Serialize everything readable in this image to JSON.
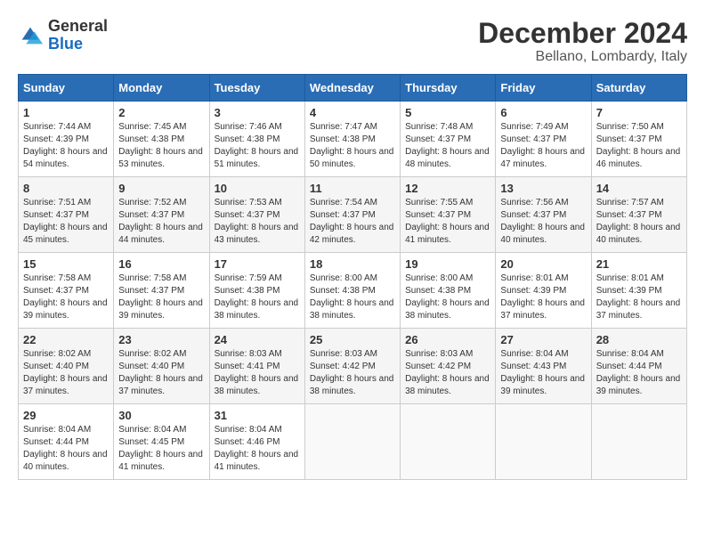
{
  "logo": {
    "general": "General",
    "blue": "Blue"
  },
  "header": {
    "month": "December 2024",
    "location": "Bellano, Lombardy, Italy"
  },
  "weekdays": [
    "Sunday",
    "Monday",
    "Tuesday",
    "Wednesday",
    "Thursday",
    "Friday",
    "Saturday"
  ],
  "weeks": [
    [
      {
        "day": "1",
        "sunrise": "7:44 AM",
        "sunset": "4:39 PM",
        "daylight": "8 hours and 54 minutes."
      },
      {
        "day": "2",
        "sunrise": "7:45 AM",
        "sunset": "4:38 PM",
        "daylight": "8 hours and 53 minutes."
      },
      {
        "day": "3",
        "sunrise": "7:46 AM",
        "sunset": "4:38 PM",
        "daylight": "8 hours and 51 minutes."
      },
      {
        "day": "4",
        "sunrise": "7:47 AM",
        "sunset": "4:38 PM",
        "daylight": "8 hours and 50 minutes."
      },
      {
        "day": "5",
        "sunrise": "7:48 AM",
        "sunset": "4:37 PM",
        "daylight": "8 hours and 48 minutes."
      },
      {
        "day": "6",
        "sunrise": "7:49 AM",
        "sunset": "4:37 PM",
        "daylight": "8 hours and 47 minutes."
      },
      {
        "day": "7",
        "sunrise": "7:50 AM",
        "sunset": "4:37 PM",
        "daylight": "8 hours and 46 minutes."
      }
    ],
    [
      {
        "day": "8",
        "sunrise": "7:51 AM",
        "sunset": "4:37 PM",
        "daylight": "8 hours and 45 minutes."
      },
      {
        "day": "9",
        "sunrise": "7:52 AM",
        "sunset": "4:37 PM",
        "daylight": "8 hours and 44 minutes."
      },
      {
        "day": "10",
        "sunrise": "7:53 AM",
        "sunset": "4:37 PM",
        "daylight": "8 hours and 43 minutes."
      },
      {
        "day": "11",
        "sunrise": "7:54 AM",
        "sunset": "4:37 PM",
        "daylight": "8 hours and 42 minutes."
      },
      {
        "day": "12",
        "sunrise": "7:55 AM",
        "sunset": "4:37 PM",
        "daylight": "8 hours and 41 minutes."
      },
      {
        "day": "13",
        "sunrise": "7:56 AM",
        "sunset": "4:37 PM",
        "daylight": "8 hours and 40 minutes."
      },
      {
        "day": "14",
        "sunrise": "7:57 AM",
        "sunset": "4:37 PM",
        "daylight": "8 hours and 40 minutes."
      }
    ],
    [
      {
        "day": "15",
        "sunrise": "7:58 AM",
        "sunset": "4:37 PM",
        "daylight": "8 hours and 39 minutes."
      },
      {
        "day": "16",
        "sunrise": "7:58 AM",
        "sunset": "4:37 PM",
        "daylight": "8 hours and 39 minutes."
      },
      {
        "day": "17",
        "sunrise": "7:59 AM",
        "sunset": "4:38 PM",
        "daylight": "8 hours and 38 minutes."
      },
      {
        "day": "18",
        "sunrise": "8:00 AM",
        "sunset": "4:38 PM",
        "daylight": "8 hours and 38 minutes."
      },
      {
        "day": "19",
        "sunrise": "8:00 AM",
        "sunset": "4:38 PM",
        "daylight": "8 hours and 38 minutes."
      },
      {
        "day": "20",
        "sunrise": "8:01 AM",
        "sunset": "4:39 PM",
        "daylight": "8 hours and 37 minutes."
      },
      {
        "day": "21",
        "sunrise": "8:01 AM",
        "sunset": "4:39 PM",
        "daylight": "8 hours and 37 minutes."
      }
    ],
    [
      {
        "day": "22",
        "sunrise": "8:02 AM",
        "sunset": "4:40 PM",
        "daylight": "8 hours and 37 minutes."
      },
      {
        "day": "23",
        "sunrise": "8:02 AM",
        "sunset": "4:40 PM",
        "daylight": "8 hours and 37 minutes."
      },
      {
        "day": "24",
        "sunrise": "8:03 AM",
        "sunset": "4:41 PM",
        "daylight": "8 hours and 38 minutes."
      },
      {
        "day": "25",
        "sunrise": "8:03 AM",
        "sunset": "4:42 PM",
        "daylight": "8 hours and 38 minutes."
      },
      {
        "day": "26",
        "sunrise": "8:03 AM",
        "sunset": "4:42 PM",
        "daylight": "8 hours and 38 minutes."
      },
      {
        "day": "27",
        "sunrise": "8:04 AM",
        "sunset": "4:43 PM",
        "daylight": "8 hours and 39 minutes."
      },
      {
        "day": "28",
        "sunrise": "8:04 AM",
        "sunset": "4:44 PM",
        "daylight": "8 hours and 39 minutes."
      }
    ],
    [
      {
        "day": "29",
        "sunrise": "8:04 AM",
        "sunset": "4:44 PM",
        "daylight": "8 hours and 40 minutes."
      },
      {
        "day": "30",
        "sunrise": "8:04 AM",
        "sunset": "4:45 PM",
        "daylight": "8 hours and 41 minutes."
      },
      {
        "day": "31",
        "sunrise": "8:04 AM",
        "sunset": "4:46 PM",
        "daylight": "8 hours and 41 minutes."
      },
      null,
      null,
      null,
      null
    ]
  ],
  "labels": {
    "sunrise": "Sunrise:",
    "sunset": "Sunset:",
    "daylight": "Daylight:"
  }
}
